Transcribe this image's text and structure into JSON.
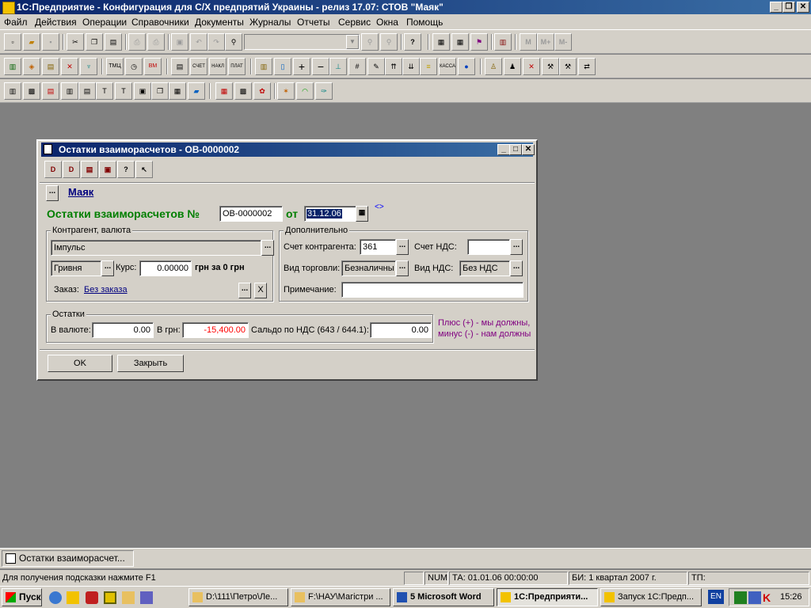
{
  "app": {
    "title": "1С:Предприятие - Конфигурация для С/Х предпрятий Украины - релиз 17.07: СТОВ \"Маяк\"",
    "window_controls": {
      "minimize": "_",
      "restore": "❐",
      "close": "✕"
    }
  },
  "menu": [
    "Файл",
    "Действия",
    "Операции",
    "Справочники",
    "Документы",
    "Журналы",
    "Отчеты",
    "Сервис",
    "Окна",
    "Помощь"
  ],
  "toolbar": {
    "calc_buttons": [
      "M",
      "M+",
      "M-"
    ],
    "small_labels": {
      "tmc": "ТМЦ",
      "bm": "BM",
      "schet": "СЧЕТ",
      "nakl": "НАКЛ",
      "plat": "ПЛАТ",
      "kassa": "КАССА"
    }
  },
  "dialog": {
    "title": "Остатки взаиморасчетов - ОВ-0000002",
    "org_name": "Маяк",
    "org_button": "...",
    "doc_title_label": "Остатки взаиморасчетов №",
    "doc_number": "ОВ-0000002",
    "date_label": "от",
    "date_value": "31.12.06",
    "date_marker": "<>",
    "group_contractor": {
      "title": "Контрагент, валюта",
      "contractor": "Імпульс",
      "currency": "Гривня",
      "rate_label": "Курс:",
      "rate_value": "0.00000",
      "rate_unit": "грн за 0 грн",
      "order_label": "Заказ:",
      "order_value": "Без заказа",
      "clear_button": "X"
    },
    "group_extra": {
      "title": "Дополнительно",
      "account_label": "Счет контрагента:",
      "account_value": "361",
      "vat_account_label": "Счет НДС:",
      "vat_account_value": "",
      "trade_type_label": "Вид торговли:",
      "trade_type_value": "Безналичны",
      "vat_type_label": "Вид НДС:",
      "vat_type_value": "Без НДС",
      "note_label": "Примечание:",
      "note_value": ""
    },
    "group_balance": {
      "title": "Остатки",
      "in_currency_label": "В валюте:",
      "in_currency_value": "0.00",
      "in_uah_label": "В грн:",
      "in_uah_value": "-15,400.00",
      "vat_balance_label": "Сальдо по НДС (643 / 644.1):",
      "vat_balance_value": "0.00"
    },
    "hint_line1": "Плюс (+) - мы должны,",
    "hint_line2": "минус (-) - нам должны",
    "ok_button": "OK",
    "close_button": "Закрыть"
  },
  "mdi_tab": "Остатки взаиморасчет...",
  "status": {
    "hint": "Для получения подсказки нажмите F1",
    "num": "NUM",
    "ta": "ТА: 01.01.06  00:00:00",
    "bi": "БИ: 1 квартал 2007 г.",
    "tp": "ТП:"
  },
  "taskbar": {
    "start": "Пуск",
    "tasks": [
      "D:\\111\\Петро\\Ле...",
      "F:\\НАУ\\Магістри ...",
      "5 Microsoft Word",
      "1С:Предприяти...",
      "Запуск 1С:Предп..."
    ],
    "active_task_index": 3,
    "lang": "EN",
    "clock": "15:26"
  },
  "colors": {
    "title_gradient_start": "#0a246a",
    "title_gradient_end": "#3a6ea5",
    "doc_title_green": "#007f00",
    "negative_red": "#ff0000",
    "hint_purple": "#800080",
    "desktop_gray": "#808080"
  }
}
